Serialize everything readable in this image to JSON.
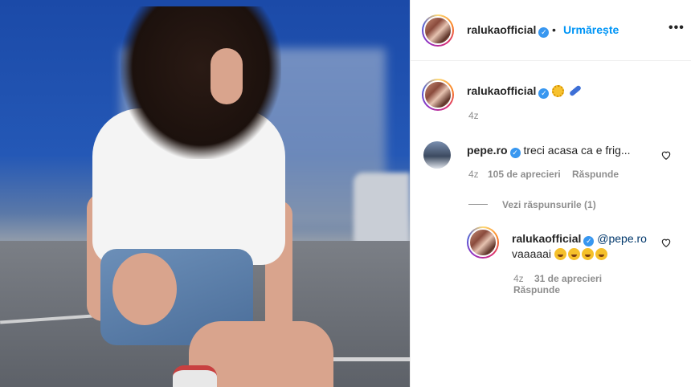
{
  "post": {
    "username": "ralukaofficial",
    "follow_label": "Urmărește",
    "more_label": "•••",
    "caption": {
      "username": "ralukaofficial",
      "time": "4z"
    }
  },
  "comments": [
    {
      "username": "pepe.ro",
      "text": "treci acasa ca e frig...",
      "time": "4z",
      "likes": "105 de aprecieri",
      "reply_label": "Răspunde",
      "view_replies": "Vezi răspunsurile (1)"
    }
  ],
  "reply": {
    "username": "ralukaofficial",
    "mention": "@pepe.ro",
    "text": "vaaaaai",
    "time": "4z",
    "likes": "31 de aprecieri",
    "reply_label": "Răspunde"
  },
  "icons": {
    "verified": "verified-badge-icon",
    "heart": "heart-outline-icon",
    "more": "more-options-icon",
    "caption_emojis": [
      "sun-emoji-icon",
      "skateboard-emoji-icon"
    ],
    "reply_emojis": [
      "grinning-emoji-icon",
      "grinning-emoji-icon",
      "grinning-emoji-icon",
      "grinning-emoji-icon"
    ]
  },
  "colors": {
    "link_blue": "#0095f6",
    "verified_blue": "#3897f0",
    "muted": "#8e8e8e"
  }
}
